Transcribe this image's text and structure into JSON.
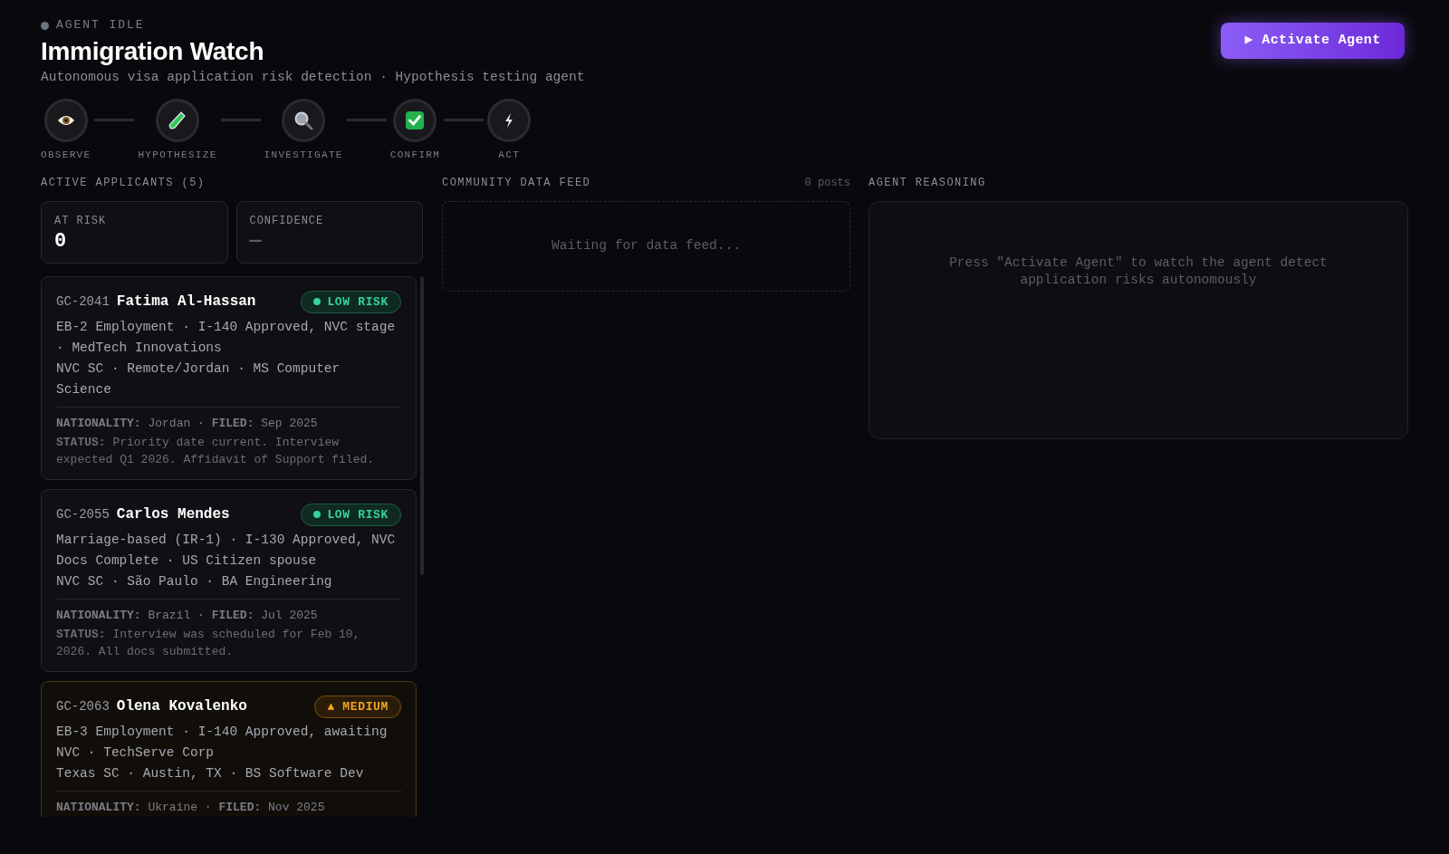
{
  "agent_status": {
    "label": "AGENT IDLE",
    "active": false
  },
  "title": "Immigration Watch",
  "subtitle": "Autonomous visa application risk detection · Hypothesis testing agent",
  "activate_button": "▶ Activate Agent",
  "steps": [
    {
      "kind": "eye",
      "label": "OBSERVE"
    },
    {
      "kind": "tube",
      "label": "HYPOTHESIZE"
    },
    {
      "kind": "search",
      "label": "INVESTIGATE"
    },
    {
      "kind": "check",
      "label": "CONFIRM"
    },
    {
      "kind": "bolt",
      "label": "ACT"
    }
  ],
  "applicants_panel": {
    "heading": "ACTIVE APPLICANTS (5)",
    "stats": [
      {
        "label": "AT RISK",
        "value": "0"
      },
      {
        "label": "CONFIDENCE",
        "value": "—"
      }
    ],
    "applicants": [
      {
        "id": "GC-2041",
        "name": "Fatima Al-Hassan",
        "kind": "low",
        "badge": "LOW RISK",
        "lines": [
          "EB-2 Employment · I-140 Approved, NVC stage · MedTech Innovations",
          "NVC SC · Remote/Jordan · MS Computer Science"
        ],
        "meta": "**NATIONALITY:** Jordan · **FILED:** Sep 2025",
        "status": "**STATUS:** Priority date current. Interview expected Q1 2026. Affidavit of Support filed."
      },
      {
        "id": "GC-2055",
        "name": "Carlos Mendes",
        "kind": "low",
        "badge": "LOW RISK",
        "lines": [
          "Marriage-based (IR-1) · I-130 Approved, NVC Docs Complete · US Citizen spouse",
          "NVC SC · São Paulo · BA Engineering"
        ],
        "meta": "**NATIONALITY:** Brazil · **FILED:** Jul 2025",
        "status": "**STATUS:** Interview was scheduled for Feb 10, 2026. All docs submitted."
      },
      {
        "id": "GC-2063",
        "name": "Olena Kovalenko",
        "kind": "medium",
        "badge": "▲ MEDIUM",
        "lines": [
          "EB-3 Employment · I-140 Approved, awaiting NVC · TechServe Corp",
          "Texas SC · Austin, TX · BS Software Dev"
        ],
        "meta": "**NATIONALITY:** Ukraine · **FILED:** Nov 2025"
      }
    ]
  },
  "feed_panel": {
    "heading": "COMMUNITY DATA FEED",
    "count": "0 posts",
    "empty_message": "Waiting for data feed..."
  },
  "reasoning_panel": {
    "heading": "AGENT REASONING",
    "empty_message": "Press \"Activate Agent\" to watch the agent detect application risks autonomously"
  }
}
